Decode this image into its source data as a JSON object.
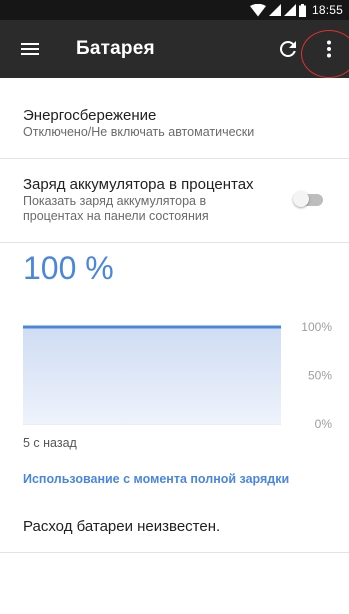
{
  "status_bar": {
    "time": "18:55",
    "icons": [
      "wifi-icon",
      "signal-icon",
      "signal-icon",
      "battery-icon"
    ]
  },
  "toolbar": {
    "title": "Батарея",
    "menu_icon": "hamburger-menu-icon",
    "refresh_icon": "refresh-icon",
    "overflow_icon": "more-vert-icon"
  },
  "battery_saver": {
    "title": "Энергосбережение",
    "summary": "Отключено/Не включать автоматически"
  },
  "battery_percentage": {
    "title": "Заряд аккумулятора в процентах",
    "summary_line1": "Показать заряд аккумулятора в",
    "summary_line2": "процентах на панели состояния",
    "enabled": false
  },
  "battery": {
    "level": "100 %"
  },
  "chart_data": {
    "type": "area",
    "x": [
      0,
      1
    ],
    "series": [
      {
        "values": [
          100,
          100
        ]
      }
    ],
    "yticks": [
      "100%",
      "50%",
      "0%"
    ],
    "ylim": [
      0,
      100
    ],
    "grid": true,
    "color": "#4a86e0",
    "title": "",
    "xlabel": "",
    "ylabel": ""
  },
  "history": {
    "time_ago": "5 с назад"
  },
  "usage": {
    "link": "Использование с момента полной зарядки",
    "text": "Расход батареи неизвестен."
  },
  "colors": {
    "accent": "#4a86e0",
    "toolbar": "#2b2b2b",
    "status_bar": "#161616",
    "highlight": "#e03030"
  }
}
